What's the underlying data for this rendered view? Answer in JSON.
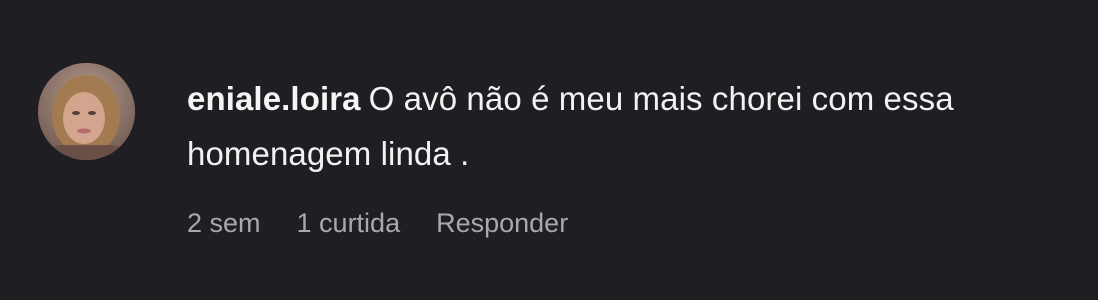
{
  "comment": {
    "username": "eniale.loira",
    "text": "O avô não é meu mais chorei com essa homenagem linda .",
    "avatar_icon": "user-avatar-photo",
    "meta": {
      "time": "2 sem",
      "likes": "1 curtida",
      "reply": "Responder"
    }
  },
  "colors": {
    "background": "#1f1f23",
    "text": "#f2f2f2",
    "meta": "#a8a8ad"
  }
}
